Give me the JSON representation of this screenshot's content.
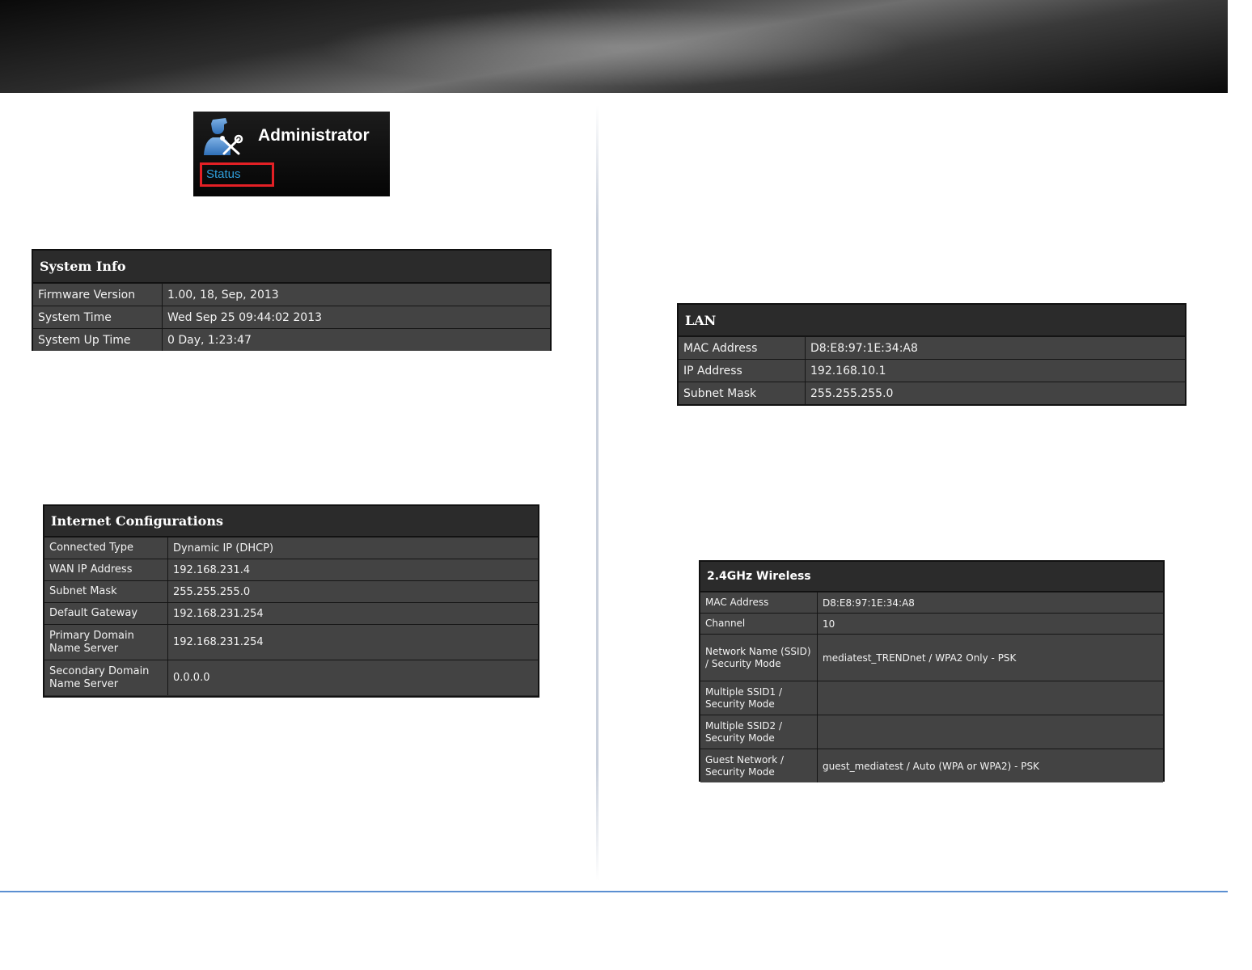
{
  "admin": {
    "title": "Administrator",
    "status_link": "Status",
    "icon": "admin-user-tools-icon",
    "highlight_color": "#e32025",
    "link_color": "#2f9fdc"
  },
  "system_info": {
    "title": "System Info",
    "rows": [
      {
        "label": "Firmware Version",
        "value": "1.00, 18, Sep, 2013"
      },
      {
        "label": "System Time",
        "value": "Wed Sep 25 09:44:02 2013"
      },
      {
        "label": "System Up Time",
        "value": "0 Day, 1:23:47"
      }
    ]
  },
  "internet_config": {
    "title": "Internet Configurations",
    "rows": [
      {
        "label": "Connected Type",
        "value": "Dynamic IP (DHCP)"
      },
      {
        "label": "WAN IP Address",
        "value": "192.168.231.4"
      },
      {
        "label": "Subnet Mask",
        "value": "255.255.255.0"
      },
      {
        "label": "Default Gateway",
        "value": "192.168.231.254"
      },
      {
        "label": "Primary Domain Name Server",
        "value": "192.168.231.254"
      },
      {
        "label": "Secondary Domain Name Server",
        "value": "0.0.0.0"
      }
    ]
  },
  "lan": {
    "title": "LAN",
    "rows": [
      {
        "label": "MAC Address",
        "value": "D8:E8:97:1E:34:A8"
      },
      {
        "label": "IP Address",
        "value": "192.168.10.1"
      },
      {
        "label": "Subnet Mask",
        "value": "255.255.255.0"
      }
    ]
  },
  "wireless_24": {
    "title": "2.4GHz Wireless",
    "rows": [
      {
        "label": "MAC Address",
        "value": "D8:E8:97:1E:34:A8"
      },
      {
        "label": "Channel",
        "value": "10"
      },
      {
        "label": "Network Name (SSID) / Security Mode",
        "value": "mediatest_TRENDnet / WPA2 Only - PSK"
      },
      {
        "label": "Multiple SSID1 / Security Mode",
        "value": ""
      },
      {
        "label": "Multiple SSID2 / Security Mode",
        "value": ""
      },
      {
        "label": "Guest Network / Security Mode",
        "value": "guest_mediatest / Auto (WPA or WPA2) - PSK"
      }
    ]
  }
}
